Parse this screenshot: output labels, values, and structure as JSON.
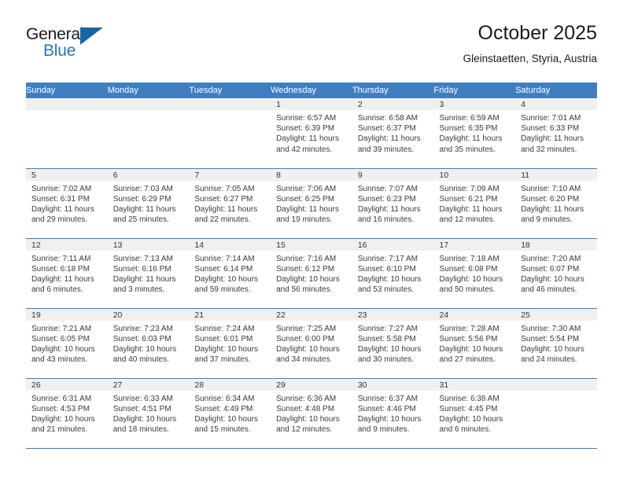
{
  "brand": {
    "name_top": "General",
    "name_bottom": "Blue",
    "icon": "triangle-logo",
    "accent_color": "#2878bd",
    "triangle_color": "#1565a8"
  },
  "header": {
    "title": "October 2025",
    "subtitle": "Gleinstaetten, Styria, Austria"
  },
  "calendar": {
    "header_bg": "#3f7fc1",
    "day_names": [
      "Sunday",
      "Monday",
      "Tuesday",
      "Wednesday",
      "Thursday",
      "Friday",
      "Saturday"
    ],
    "weeks": [
      [
        {
          "date": "",
          "empty": true,
          "lines": []
        },
        {
          "date": "",
          "empty": true,
          "lines": []
        },
        {
          "date": "",
          "empty": true,
          "lines": []
        },
        {
          "date": "1",
          "empty": false,
          "lines": [
            "Sunrise: 6:57 AM",
            "Sunset: 6:39 PM",
            "Daylight: 11 hours",
            "and 42 minutes."
          ]
        },
        {
          "date": "2",
          "empty": false,
          "lines": [
            "Sunrise: 6:58 AM",
            "Sunset: 6:37 PM",
            "Daylight: 11 hours",
            "and 39 minutes."
          ]
        },
        {
          "date": "3",
          "empty": false,
          "lines": [
            "Sunrise: 6:59 AM",
            "Sunset: 6:35 PM",
            "Daylight: 11 hours",
            "and 35 minutes."
          ]
        },
        {
          "date": "4",
          "empty": false,
          "lines": [
            "Sunrise: 7:01 AM",
            "Sunset: 6:33 PM",
            "Daylight: 11 hours",
            "and 32 minutes."
          ]
        }
      ],
      [
        {
          "date": "5",
          "empty": false,
          "lines": [
            "Sunrise: 7:02 AM",
            "Sunset: 6:31 PM",
            "Daylight: 11 hours",
            "and 29 minutes."
          ]
        },
        {
          "date": "6",
          "empty": false,
          "lines": [
            "Sunrise: 7:03 AM",
            "Sunset: 6:29 PM",
            "Daylight: 11 hours",
            "and 25 minutes."
          ]
        },
        {
          "date": "7",
          "empty": false,
          "lines": [
            "Sunrise: 7:05 AM",
            "Sunset: 6:27 PM",
            "Daylight: 11 hours",
            "and 22 minutes."
          ]
        },
        {
          "date": "8",
          "empty": false,
          "lines": [
            "Sunrise: 7:06 AM",
            "Sunset: 6:25 PM",
            "Daylight: 11 hours",
            "and 19 minutes."
          ]
        },
        {
          "date": "9",
          "empty": false,
          "lines": [
            "Sunrise: 7:07 AM",
            "Sunset: 6:23 PM",
            "Daylight: 11 hours",
            "and 16 minutes."
          ]
        },
        {
          "date": "10",
          "empty": false,
          "lines": [
            "Sunrise: 7:09 AM",
            "Sunset: 6:21 PM",
            "Daylight: 11 hours",
            "and 12 minutes."
          ]
        },
        {
          "date": "11",
          "empty": false,
          "lines": [
            "Sunrise: 7:10 AM",
            "Sunset: 6:20 PM",
            "Daylight: 11 hours",
            "and 9 minutes."
          ]
        }
      ],
      [
        {
          "date": "12",
          "empty": false,
          "lines": [
            "Sunrise: 7:11 AM",
            "Sunset: 6:18 PM",
            "Daylight: 11 hours",
            "and 6 minutes."
          ]
        },
        {
          "date": "13",
          "empty": false,
          "lines": [
            "Sunrise: 7:13 AM",
            "Sunset: 6:16 PM",
            "Daylight: 11 hours",
            "and 3 minutes."
          ]
        },
        {
          "date": "14",
          "empty": false,
          "lines": [
            "Sunrise: 7:14 AM",
            "Sunset: 6:14 PM",
            "Daylight: 10 hours",
            "and 59 minutes."
          ]
        },
        {
          "date": "15",
          "empty": false,
          "lines": [
            "Sunrise: 7:16 AM",
            "Sunset: 6:12 PM",
            "Daylight: 10 hours",
            "and 56 minutes."
          ]
        },
        {
          "date": "16",
          "empty": false,
          "lines": [
            "Sunrise: 7:17 AM",
            "Sunset: 6:10 PM",
            "Daylight: 10 hours",
            "and 53 minutes."
          ]
        },
        {
          "date": "17",
          "empty": false,
          "lines": [
            "Sunrise: 7:18 AM",
            "Sunset: 6:08 PM",
            "Daylight: 10 hours",
            "and 50 minutes."
          ]
        },
        {
          "date": "18",
          "empty": false,
          "lines": [
            "Sunrise: 7:20 AM",
            "Sunset: 6:07 PM",
            "Daylight: 10 hours",
            "and 46 minutes."
          ]
        }
      ],
      [
        {
          "date": "19",
          "empty": false,
          "lines": [
            "Sunrise: 7:21 AM",
            "Sunset: 6:05 PM",
            "Daylight: 10 hours",
            "and 43 minutes."
          ]
        },
        {
          "date": "20",
          "empty": false,
          "lines": [
            "Sunrise: 7:23 AM",
            "Sunset: 6:03 PM",
            "Daylight: 10 hours",
            "and 40 minutes."
          ]
        },
        {
          "date": "21",
          "empty": false,
          "lines": [
            "Sunrise: 7:24 AM",
            "Sunset: 6:01 PM",
            "Daylight: 10 hours",
            "and 37 minutes."
          ]
        },
        {
          "date": "22",
          "empty": false,
          "lines": [
            "Sunrise: 7:25 AM",
            "Sunset: 6:00 PM",
            "Daylight: 10 hours",
            "and 34 minutes."
          ]
        },
        {
          "date": "23",
          "empty": false,
          "lines": [
            "Sunrise: 7:27 AM",
            "Sunset: 5:58 PM",
            "Daylight: 10 hours",
            "and 30 minutes."
          ]
        },
        {
          "date": "24",
          "empty": false,
          "lines": [
            "Sunrise: 7:28 AM",
            "Sunset: 5:56 PM",
            "Daylight: 10 hours",
            "and 27 minutes."
          ]
        },
        {
          "date": "25",
          "empty": false,
          "lines": [
            "Sunrise: 7:30 AM",
            "Sunset: 5:54 PM",
            "Daylight: 10 hours",
            "and 24 minutes."
          ]
        }
      ],
      [
        {
          "date": "26",
          "empty": false,
          "lines": [
            "Sunrise: 6:31 AM",
            "Sunset: 4:53 PM",
            "Daylight: 10 hours",
            "and 21 minutes."
          ]
        },
        {
          "date": "27",
          "empty": false,
          "lines": [
            "Sunrise: 6:33 AM",
            "Sunset: 4:51 PM",
            "Daylight: 10 hours",
            "and 18 minutes."
          ]
        },
        {
          "date": "28",
          "empty": false,
          "lines": [
            "Sunrise: 6:34 AM",
            "Sunset: 4:49 PM",
            "Daylight: 10 hours",
            "and 15 minutes."
          ]
        },
        {
          "date": "29",
          "empty": false,
          "lines": [
            "Sunrise: 6:36 AM",
            "Sunset: 4:48 PM",
            "Daylight: 10 hours",
            "and 12 minutes."
          ]
        },
        {
          "date": "30",
          "empty": false,
          "lines": [
            "Sunrise: 6:37 AM",
            "Sunset: 4:46 PM",
            "Daylight: 10 hours",
            "and 9 minutes."
          ]
        },
        {
          "date": "31",
          "empty": false,
          "lines": [
            "Sunrise: 6:38 AM",
            "Sunset: 4:45 PM",
            "Daylight: 10 hours",
            "and 6 minutes."
          ]
        },
        {
          "date": "",
          "empty": true,
          "lines": []
        }
      ]
    ]
  }
}
